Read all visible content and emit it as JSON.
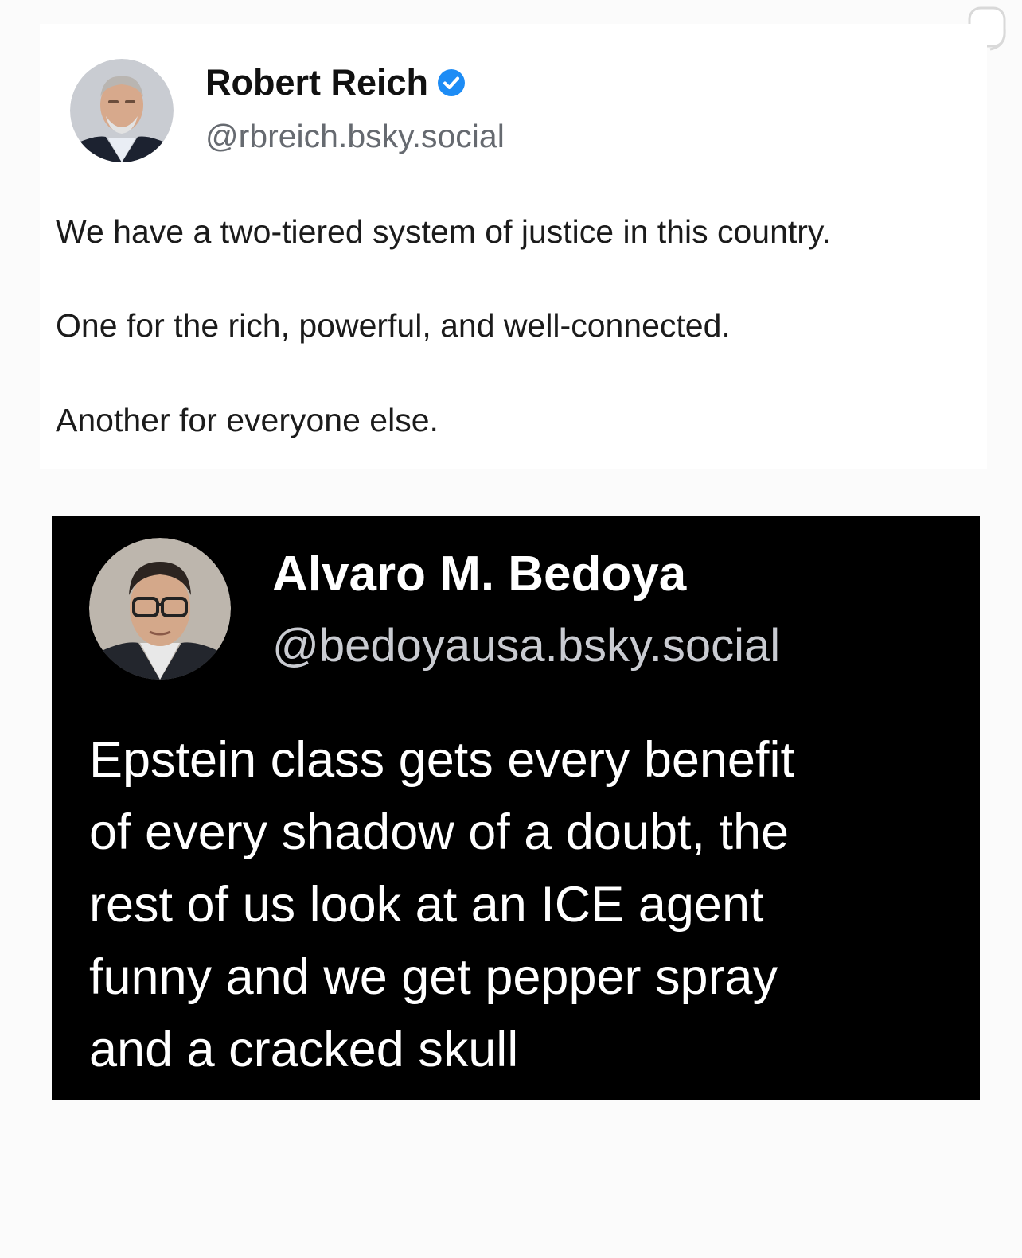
{
  "post": {
    "author_name": "Robert Reich",
    "author_handle": "@rbreich.bsky.social",
    "verified": true,
    "lines": [
      "We have a two-tiered system of justice in this country.",
      "One for the rich, powerful, and well-connected.",
      "Another for everyone else."
    ]
  },
  "quoted_post": {
    "author_name": "Alvaro M. Bedoya",
    "author_handle": "@bedoyausa.bsky.social",
    "lines": [
      "Epstein class gets every benefit",
      "of every shadow of a doubt, the",
      "rest of us look at an ICE agent",
      "funny and we get pepper spray",
      "and a cracked skull"
    ]
  },
  "colors": {
    "verified_badge": "#1d8cf5",
    "quote_background": "#000000",
    "handle_gray": "#666a70"
  },
  "icons": {
    "verified": "verified-badge-icon",
    "corner": "corner-overlay-icon"
  }
}
